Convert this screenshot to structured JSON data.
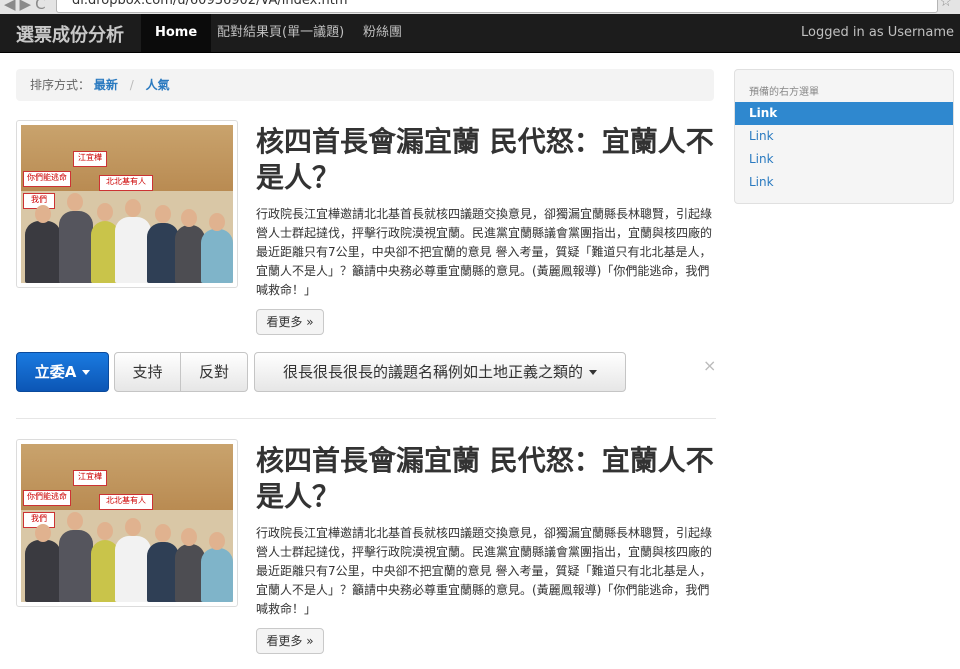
{
  "browser": {
    "url": "dl.dropbox.com/u/60936902/VA/index.htm"
  },
  "navbar": {
    "brand": "選票成份分析",
    "items": [
      "Home",
      "配對結果頁(單一議題)",
      "粉絲團"
    ],
    "login": "Logged in as Username"
  },
  "breadcrumb": {
    "label": "排序方式：",
    "links": [
      "最新",
      "人氣"
    ],
    "separator": "/"
  },
  "sidebar": {
    "header": "預備的右方選單",
    "items": [
      "Link",
      "Link",
      "Link",
      "Link"
    ]
  },
  "articles": [
    {
      "title": "核四首長會漏宜蘭 民代怒：宜蘭人不是人？",
      "summary": "行政院長江宜樺邀請北北基首長就核四議題交換意見，卻獨漏宜蘭縣長林聰賢，引起綠營人士群起撻伐，抨擊行政院漠視宜蘭。民進黨宜蘭縣議會黨團指出，宜蘭與核四廠的最近距離只有7公里，中央卻不把宜蘭的意見 譽入考量，質疑「難道只有北北基是人，宜蘭人不是人」？籲請中央務必尊重宜蘭縣的意見。(黃麗鳳報導)「你們能逃命，我們喊救命！」",
      "more": "看更多 »",
      "photo_signs": [
        "江宜樺",
        "北北基有人",
        "你們能逃命",
        "我們"
      ]
    },
    {
      "title": "核四首長會漏宜蘭 民代怒：宜蘭人不是人？",
      "summary": "行政院長江宜樺邀請北北基首長就核四議題交換意見，卻獨漏宜蘭縣長林聰賢，引起綠營人士群起撻伐，抨擊行政院漠視宜蘭。民進黨宜蘭縣議會黨團指出，宜蘭與核四廠的最近距離只有7公里，中央卻不把宜蘭的意見 譽入考量，質疑「難道只有北北基是人，宜蘭人不是人」？籲請中央務必尊重宜蘭縣的意見。(黃麗鳳報導)「你們能逃命，我們喊救命！」",
      "more": "看更多 »",
      "photo_signs": [
        "江宜樺",
        "北北基有人",
        "你們能逃命",
        "我們"
      ]
    }
  ],
  "votebar": {
    "legislator": "立委A",
    "support": "支持",
    "oppose": "反對",
    "issue": "很長很長很長的議題名稱例如土地正義之類的",
    "close": "×"
  },
  "colors": {
    "navbar": "#1c1c1c",
    "primary": "#0c56b5",
    "link": "#2a7ac0",
    "sidebar_active": "#2f88cf"
  }
}
